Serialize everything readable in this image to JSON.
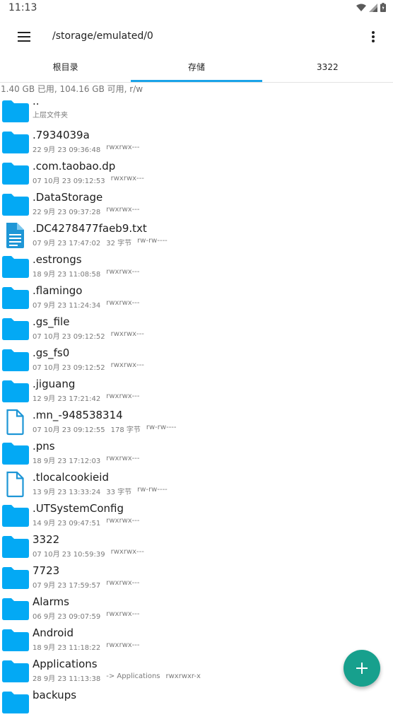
{
  "status_bar": {
    "time": "11:13"
  },
  "toolbar": {
    "path": "/storage/emulated/0"
  },
  "tabs": [
    {
      "label": "根目录",
      "active": false
    },
    {
      "label": "存储",
      "active": true
    },
    {
      "label": "3322",
      "active": false
    }
  ],
  "storage_info": "1.40 GB 已用, 104.16 GB 可用, r/w",
  "files": [
    {
      "name": "..",
      "date": "上层文件夹",
      "size": "",
      "perm": "",
      "kind": "folder"
    },
    {
      "name": ".7934039a",
      "date": "22 9月 23 09:36:48",
      "size": "",
      "perm": "rwxrwx---",
      "kind": "folder"
    },
    {
      "name": ".com.taobao.dp",
      "date": "07 10月 23 09:12:53",
      "size": "",
      "perm": "rwxrwx---",
      "kind": "folder"
    },
    {
      "name": ".DataStorage",
      "date": "22 9月 23 09:37:28",
      "size": "",
      "perm": "rwxrwx---",
      "kind": "folder"
    },
    {
      "name": ".DC4278477faeb9.txt",
      "date": "07 9月 23 17:47:02",
      "size": "32 字节",
      "perm": "rw-rw----",
      "kind": "text"
    },
    {
      "name": ".estrongs",
      "date": "18 9月 23 11:08:58",
      "size": "",
      "perm": "rwxrwx---",
      "kind": "folder"
    },
    {
      "name": ".flamingo",
      "date": "07 9月 23 11:24:34",
      "size": "",
      "perm": "rwxrwx---",
      "kind": "folder"
    },
    {
      "name": ".gs_file",
      "date": "07 10月 23 09:12:52",
      "size": "",
      "perm": "rwxrwx---",
      "kind": "folder"
    },
    {
      "name": ".gs_fs0",
      "date": "07 10月 23 09:12:52",
      "size": "",
      "perm": "rwxrwx---",
      "kind": "folder"
    },
    {
      "name": ".jiguang",
      "date": "12 9月 23 17:21:42",
      "size": "",
      "perm": "rwxrwx---",
      "kind": "folder"
    },
    {
      "name": ".mn_-948538314",
      "date": "07 10月 23 09:12:55",
      "size": "178 字节",
      "perm": "rw-rw----",
      "kind": "file"
    },
    {
      "name": ".pns",
      "date": "18 9月 23 17:12:03",
      "size": "",
      "perm": "rwxrwx---",
      "kind": "folder"
    },
    {
      "name": ".tlocalcookieid",
      "date": "13 9月 23 13:33:24",
      "size": "33 字节",
      "perm": "rw-rw----",
      "kind": "file"
    },
    {
      "name": ".UTSystemConfig",
      "date": "14 9月 23 09:47:51",
      "size": "",
      "perm": "rwxrwx---",
      "kind": "folder"
    },
    {
      "name": "3322",
      "date": "07 10月 23 10:59:39",
      "size": "",
      "perm": "rwxrwx---",
      "kind": "folder"
    },
    {
      "name": "7723",
      "date": "07 9月 23 17:59:57",
      "size": "",
      "perm": "rwxrwx---",
      "kind": "folder"
    },
    {
      "name": "Alarms",
      "date": "06 9月 23 09:07:59",
      "size": "",
      "perm": "rwxrwx---",
      "kind": "folder"
    },
    {
      "name": "Android",
      "date": "18 9月 23 11:18:22",
      "size": "",
      "perm": "rwxrwx---",
      "kind": "folder"
    },
    {
      "name": "Applications",
      "date": "28 9月 23 11:13:38",
      "size": "-> Applications",
      "perm": "rwxrwxr-x",
      "kind": "folder"
    },
    {
      "name": "backups",
      "date": "",
      "size": "",
      "perm": "",
      "kind": "folder"
    }
  ],
  "colors": {
    "accent": "#1aa3e8",
    "folder": "#03a9f4",
    "fab": "#17a08d"
  },
  "icons": {
    "menu": "hamburger-menu-icon",
    "more": "more-vert-icon",
    "fab": "plus-icon"
  }
}
